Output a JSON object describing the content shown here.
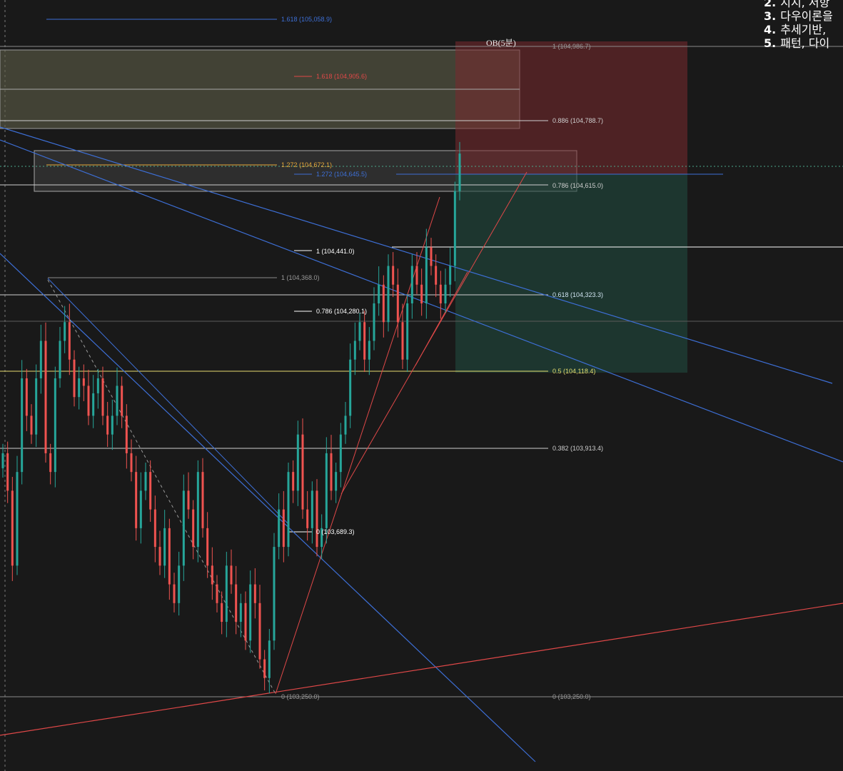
{
  "chart_data": {
    "type": "candlestick",
    "notes": [
      {
        "num": "2.",
        "text": "지지, 저항"
      },
      {
        "num": "3.",
        "text": "다우이론을"
      },
      {
        "num": "4.",
        "text": "추세기반,"
      },
      {
        "num": "5.",
        "text": "패턴, 다이"
      }
    ],
    "order_block": {
      "label": "OB(5분)"
    },
    "fib_levels": [
      {
        "label": "1.618 (105,058.9)",
        "value": 105058.9,
        "color": "#3d6fd6"
      },
      {
        "label": "1 (104,986.7)",
        "value": 104986.7,
        "color": "#9a9a9a"
      },
      {
        "label": "1.618 (104,905.6)",
        "value": 104905.6,
        "color": "#e04848"
      },
      {
        "label": "0.886 (104,788.7)",
        "value": 104788.7,
        "color": "#cfcfcf"
      },
      {
        "label": "1.272 (104,672.1)",
        "value": 104672.1,
        "color": "#e7a83a"
      },
      {
        "label": "1.272 (104,645.5)",
        "value": 104645.5,
        "color": "#3d6fd6"
      },
      {
        "label": "0.786 (104,615.0)",
        "value": 104615.0,
        "color": "#cfcfcf"
      },
      {
        "label": "1 (104,441.0)",
        "value": 104441.0,
        "color": "#ffffff"
      },
      {
        "label": "1 (104,368.0)",
        "value": 104368.0,
        "color": "#9a9a9a"
      },
      {
        "label": "0.618 (104,323.3)",
        "value": 104323.3,
        "color": "#cfe3f0"
      },
      {
        "label": "0.786 (104,280.1)",
        "value": 104280.1,
        "color": "#ffffff"
      },
      {
        "label": "0.5 (104,118.4)",
        "value": 104118.4,
        "color": "#e6dc6e"
      },
      {
        "label": "0.382 (103,913.4)",
        "value": 103913.4,
        "color": "#cfcfcf"
      },
      {
        "label": "0 (103,689.3)",
        "value": 103689.3,
        "color": "#ffffff"
      },
      {
        "label": "0 (103,250.0)",
        "value": 103250.0,
        "color": "#9a9a9a"
      }
    ],
    "series": [
      {
        "name": "",
        "closes": [
          103900,
          103800,
          103600,
          103850,
          104100,
          104000,
          103950,
          104100,
          104200,
          103900,
          103850,
          104100,
          104200,
          104250,
          104150,
          104050,
          104100,
          104080,
          104000,
          104060,
          104100,
          104000,
          103950,
          104000,
          104080,
          104000,
          103900,
          103850,
          103700,
          103800,
          103850,
          103750,
          103650,
          103600,
          103700,
          103550,
          103500,
          103600,
          103800,
          103750,
          103650,
          103850,
          103700,
          103600,
          103550,
          103500,
          103450,
          103600,
          103550,
          103450,
          103500,
          103400,
          103550,
          103500,
          103350,
          103300,
          103400,
          103650,
          103750,
          103650,
          103850,
          103800,
          103950,
          103750,
          103700,
          103800,
          103650,
          103700,
          103900,
          103800,
          103850,
          103950,
          104000,
          104150,
          104200,
          104250,
          104150,
          104200,
          104300,
          104350,
          104250,
          104400,
          104350,
          104250,
          104150,
          104300,
          104400,
          104350,
          104300,
          104450,
          104400,
          104350,
          104300,
          104350,
          104400,
          104600,
          104700
        ],
        "colors": {
          "up": "#26a69a",
          "down": "#ef5350"
        }
      }
    ],
    "ylim": [
      103150,
      105150
    ],
    "grid": false
  }
}
